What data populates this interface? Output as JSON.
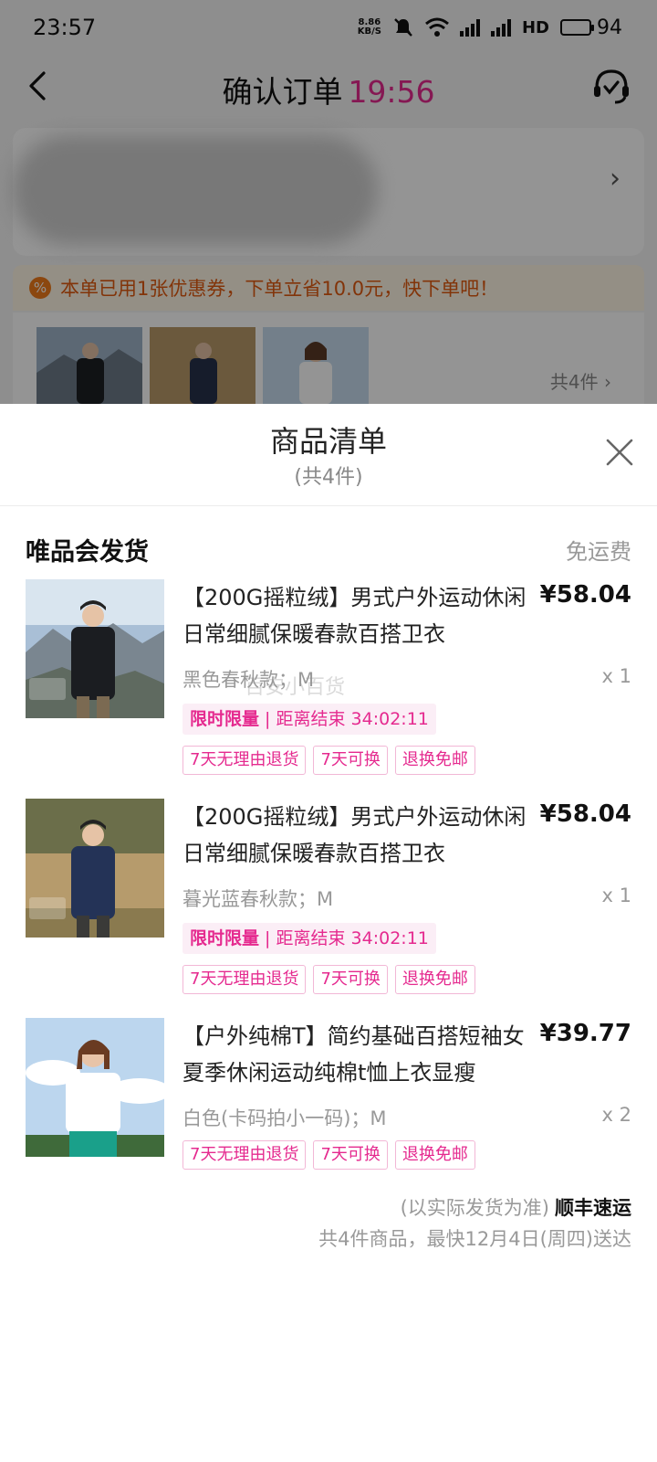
{
  "status_bar": {
    "time": "23:57",
    "net_speed_value": "8.86",
    "net_speed_unit": "KB/S",
    "network_type": "5G",
    "hd_label": "HD",
    "battery": "94"
  },
  "nav": {
    "title": "确认订单",
    "timer": "19:56"
  },
  "coupon_notice": "本单已用1张优惠券，下单立省10.0元，快下单吧！",
  "preview": {
    "count_label": "共4件"
  },
  "sheet": {
    "title": "商品清单",
    "subtitle": "(共4件)"
  },
  "shipper": {
    "name": "唯品会发货",
    "shipping_fee": "免运费"
  },
  "watermark": "百安小百货",
  "items": [
    {
      "title": "【200G摇粒绒】男式户外运动休闲日常细腻保暖春款百搭卫衣",
      "price": "¥58.04",
      "spec": "黑色春秋款；M",
      "qty": "x 1",
      "flash_label": "限时限量",
      "flash_countdown": "距离结束 34:02:11",
      "tags": [
        "7天无理由退货",
        "7天可换",
        "退换免邮"
      ]
    },
    {
      "title": "【200G摇粒绒】男式户外运动休闲日常细腻保暖春款百搭卫衣",
      "price": "¥58.04",
      "spec": "暮光蓝春秋款；M",
      "qty": "x 1",
      "flash_label": "限时限量",
      "flash_countdown": "距离结束 34:02:11",
      "tags": [
        "7天无理由退货",
        "7天可换",
        "退换免邮"
      ]
    },
    {
      "title": "【户外纯棉T】简约基础百搭短袖女夏季休闲运动纯棉t恤上衣显瘦",
      "price": "¥39.77",
      "spec": "白色(卡码拍小一码)；M",
      "qty": "x 2",
      "tags": [
        "7天无理由退货",
        "7天可换",
        "退换免邮"
      ]
    }
  ],
  "delivery": {
    "note": "(以实际发货为准)",
    "carrier": "顺丰速运",
    "summary": "共4件商品，最快12月4日(周四)送达"
  },
  "colors": {
    "accent": "#e52a8f",
    "coupon": "#e05a10",
    "muted": "#999999"
  }
}
